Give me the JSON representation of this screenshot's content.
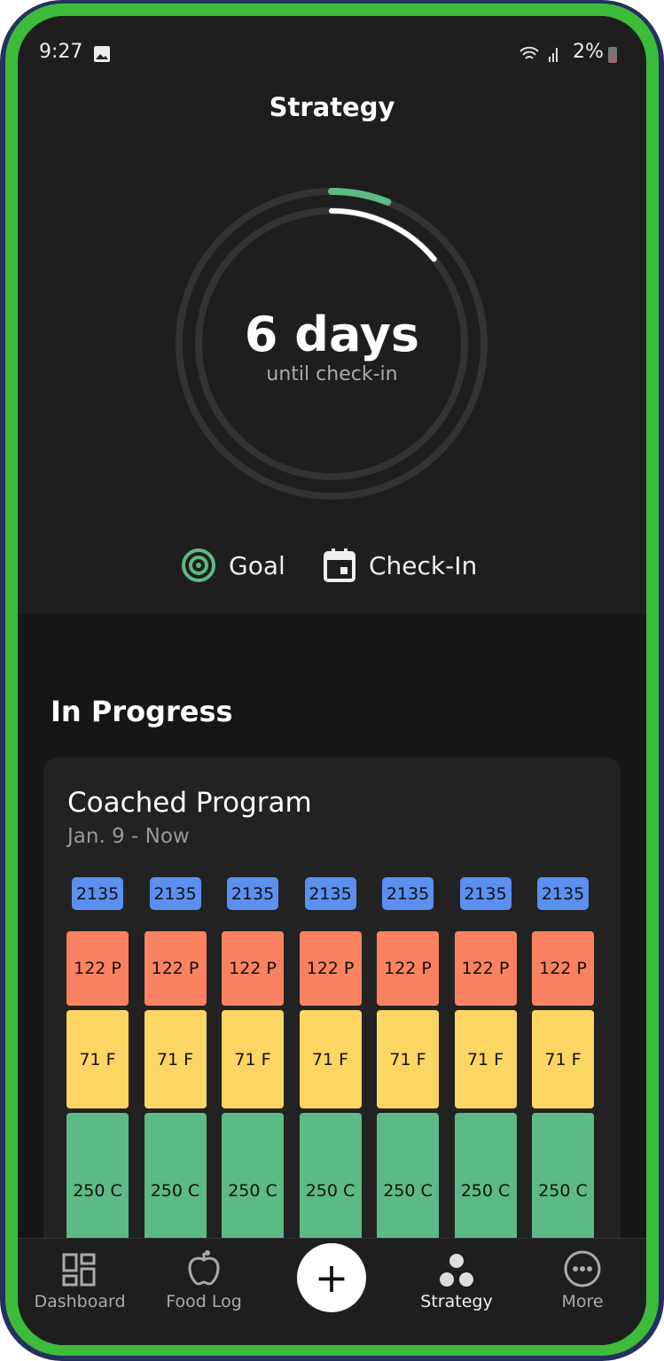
{
  "status": {
    "time": "9:27",
    "battery": "2%",
    "icons": [
      "image-icon",
      "wifi-icon",
      "signal-icon",
      "battery-icon"
    ]
  },
  "header": {
    "title": "Strategy"
  },
  "countdown": {
    "value": "6 days",
    "label": "until check-in",
    "goal_ring_progress": 0.06,
    "checkin_ring_progress": 0.14
  },
  "actions": {
    "goal": "Goal",
    "checkin": "Check-In"
  },
  "section": {
    "title": "In Progress"
  },
  "program": {
    "title": "Coached Program",
    "dates": "Jan. 9 - Now",
    "days": [
      {
        "cal": "2135",
        "protein": "122 P",
        "fat": "71 F",
        "carbs": "250 C"
      },
      {
        "cal": "2135",
        "protein": "122 P",
        "fat": "71 F",
        "carbs": "250 C"
      },
      {
        "cal": "2135",
        "protein": "122 P",
        "fat": "71 F",
        "carbs": "250 C"
      },
      {
        "cal": "2135",
        "protein": "122 P",
        "fat": "71 F",
        "carbs": "250 C"
      },
      {
        "cal": "2135",
        "protein": "122 P",
        "fat": "71 F",
        "carbs": "250 C"
      },
      {
        "cal": "2135",
        "protein": "122 P",
        "fat": "71 F",
        "carbs": "250 C"
      },
      {
        "cal": "2135",
        "protein": "122 P",
        "fat": "71 F",
        "carbs": "250 C"
      }
    ]
  },
  "colors": {
    "calories": "#5b8ff0",
    "protein": "#fb8260",
    "fat": "#fdd563",
    "carbs": "#5dba84",
    "accent": "#5dba84"
  },
  "nav": {
    "dashboard": "Dashboard",
    "food_log": "Food Log",
    "add": "+",
    "strategy": "Strategy",
    "more": "More"
  }
}
